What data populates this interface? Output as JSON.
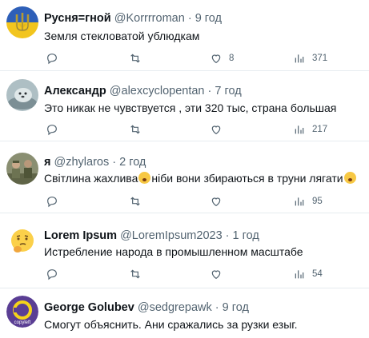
{
  "replies": [
    {
      "name": "Русня=гной",
      "handle": "@Korrrroman",
      "time": "9 год",
      "text": "Земля стекловатой ублюдкам",
      "reply_count": "",
      "retweet_count": "",
      "like_count": "8",
      "views": "371",
      "avatar": "ukraine-flag-trident"
    },
    {
      "name": "Александр",
      "handle": "@alexcyclopentan",
      "time": "7 год",
      "text": "Это никак не чувствуется , эти 320  тыс, страна большая",
      "reply_count": "",
      "retweet_count": "",
      "like_count": "",
      "views": "217",
      "avatar": "seal-photo"
    },
    {
      "name": "я",
      "handle": "@zhylaros",
      "time": "2 год",
      "text_before": "Світлина жахлива",
      "text_middle": "ніби вони збираються в труни лягати",
      "reply_count": "",
      "retweet_count": "",
      "like_count": "",
      "views": "95",
      "avatar": "soldiers-photo",
      "emoji1": "fearful-face-emoji",
      "emoji2": "crying-laughing-face-emoji"
    },
    {
      "name": "Lorem Ipsum",
      "handle": "@LoremIpsum2023",
      "time": "1 год",
      "text": "Истребление народа в промышленном масштабе",
      "reply_count": "",
      "retweet_count": "",
      "like_count": "",
      "views": "54",
      "avatar": "thinking-face-emoji"
    },
    {
      "name": "George Golubev",
      "handle": "@sedgrepawk",
      "time": "9 год",
      "text": "Смогут объяснить. Ани сражались за рузки езыг.",
      "avatar": "copyleft-logo",
      "avatar_text": "copyleft"
    }
  ],
  "separator": "·",
  "colors": {
    "text": "#0f1419",
    "muted": "#536471",
    "border": "#e6ecf0",
    "avatar_copyleft": "#5a3e94",
    "avatar_copyleft_ring": "#f5d31a"
  },
  "icons": [
    "reply-icon",
    "retweet-icon",
    "like-icon",
    "views-icon"
  ]
}
